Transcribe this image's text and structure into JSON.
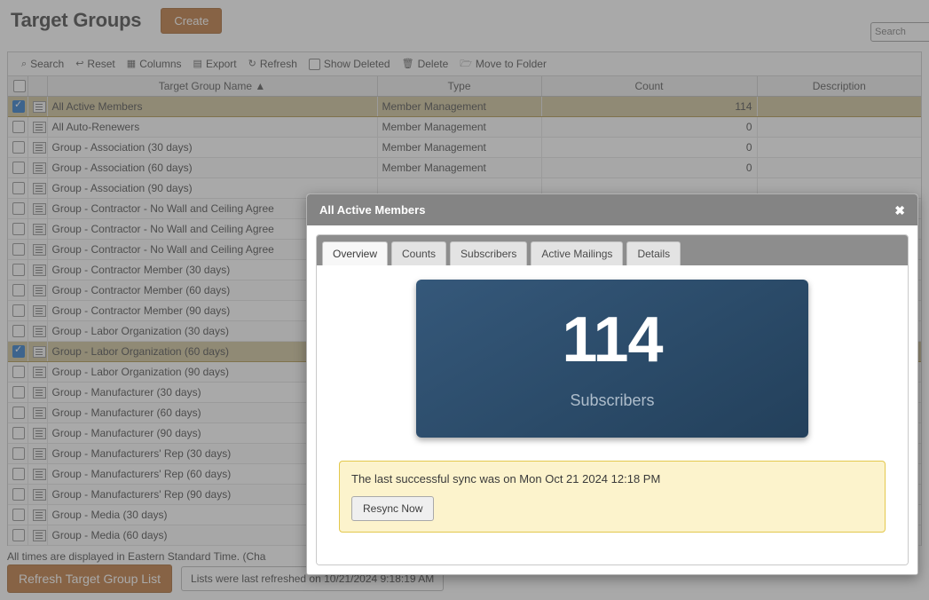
{
  "header": {
    "title": "Target Groups",
    "create_label": "Create",
    "search_placeholder": "Search"
  },
  "toolbar": {
    "items": [
      {
        "icon": "search-icon",
        "glyph": "⌕",
        "label": "Search"
      },
      {
        "icon": "reset-icon",
        "glyph": "↩",
        "label": "Reset"
      },
      {
        "icon": "columns-icon",
        "glyph": "▦",
        "label": "Columns"
      },
      {
        "icon": "export-icon",
        "glyph": "▤",
        "label": "Export"
      },
      {
        "icon": "refresh-icon",
        "glyph": "↻",
        "label": "Refresh"
      },
      {
        "icon": "checkbox-icon",
        "glyph": "",
        "label": "Show Deleted"
      },
      {
        "icon": "trash-icon",
        "glyph": "🗑",
        "label": "Delete"
      },
      {
        "icon": "move-to-folder-icon",
        "glyph": "🗁",
        "label": "Move to Folder"
      }
    ]
  },
  "grid": {
    "columns": [
      "Target Group Name",
      "Type",
      "Count",
      "Description"
    ],
    "sort_indicator": "▲",
    "rows": [
      {
        "checked": true,
        "name": "All Active Members",
        "type": "Member Management",
        "count": "114",
        "description": ""
      },
      {
        "checked": false,
        "name": "All Auto-Renewers",
        "type": "Member Management",
        "count": "0",
        "description": ""
      },
      {
        "checked": false,
        "name": "Group - Association (30 days)",
        "type": "Member Management",
        "count": "0",
        "description": ""
      },
      {
        "checked": false,
        "name": "Group - Association (60 days)",
        "type": "Member Management",
        "count": "0",
        "description": ""
      },
      {
        "checked": false,
        "name": "Group - Association (90 days)",
        "type": "",
        "count": "",
        "description": ""
      },
      {
        "checked": false,
        "name": "Group - Contractor - No Wall and Ceiling Agree",
        "type": "",
        "count": "",
        "description": ""
      },
      {
        "checked": false,
        "name": "Group - Contractor - No Wall and Ceiling Agree",
        "type": "",
        "count": "",
        "description": ""
      },
      {
        "checked": false,
        "name": "Group - Contractor - No Wall and Ceiling Agree",
        "type": "",
        "count": "",
        "description": ""
      },
      {
        "checked": false,
        "name": "Group - Contractor Member (30 days)",
        "type": "",
        "count": "",
        "description": ""
      },
      {
        "checked": false,
        "name": "Group - Contractor Member (60 days)",
        "type": "",
        "count": "",
        "description": ""
      },
      {
        "checked": false,
        "name": "Group - Contractor Member (90 days)",
        "type": "",
        "count": "",
        "description": ""
      },
      {
        "checked": false,
        "name": "Group - Labor Organization (30 days)",
        "type": "",
        "count": "",
        "description": ""
      },
      {
        "checked": true,
        "name": "Group - Labor Organization (60 days)",
        "type": "",
        "count": "",
        "description": ""
      },
      {
        "checked": false,
        "name": "Group - Labor Organization (90 days)",
        "type": "",
        "count": "",
        "description": ""
      },
      {
        "checked": false,
        "name": "Group - Manufacturer (30 days)",
        "type": "",
        "count": "",
        "description": ""
      },
      {
        "checked": false,
        "name": "Group - Manufacturer (60 days)",
        "type": "",
        "count": "",
        "description": ""
      },
      {
        "checked": false,
        "name": "Group - Manufacturer (90 days)",
        "type": "",
        "count": "",
        "description": ""
      },
      {
        "checked": false,
        "name": "Group - Manufacturers' Rep (30 days)",
        "type": "",
        "count": "",
        "description": ""
      },
      {
        "checked": false,
        "name": "Group - Manufacturers' Rep (60 days)",
        "type": "",
        "count": "",
        "description": ""
      },
      {
        "checked": false,
        "name": "Group - Manufacturers' Rep (90 days)",
        "type": "",
        "count": "",
        "description": ""
      },
      {
        "checked": false,
        "name": "Group - Media (30 days)",
        "type": "",
        "count": "",
        "description": ""
      },
      {
        "checked": false,
        "name": "Group - Media (60 days)",
        "type": "",
        "count": "",
        "description": ""
      }
    ]
  },
  "footer": {
    "timezone_note": "All times are displayed in Eastern Standard Time. (Cha",
    "refresh_button": "Refresh Target Group List",
    "refresh_stamp": "Lists were last refreshed on 10/21/2024 9:18:19 AM"
  },
  "modal": {
    "title": "All Active Members",
    "close_glyph": "✖",
    "tabs": [
      {
        "label": "Overview",
        "active": true
      },
      {
        "label": "Counts",
        "active": false
      },
      {
        "label": "Subscribers",
        "active": false
      },
      {
        "label": "Active Mailings",
        "active": false
      },
      {
        "label": "Details",
        "active": false
      }
    ],
    "stat": {
      "value": "114",
      "label": "Subscribers"
    },
    "sync": {
      "message": "The last successful sync was on Mon Oct 21 2024 12:18 PM",
      "button": "Resync Now"
    }
  },
  "colors": {
    "accent_orange": "#b86e2e",
    "card_blue": "#2b4b69",
    "selected_row": "#cbbf92",
    "modal_header": "#848484",
    "sync_yellow": "#fcf3cc"
  }
}
